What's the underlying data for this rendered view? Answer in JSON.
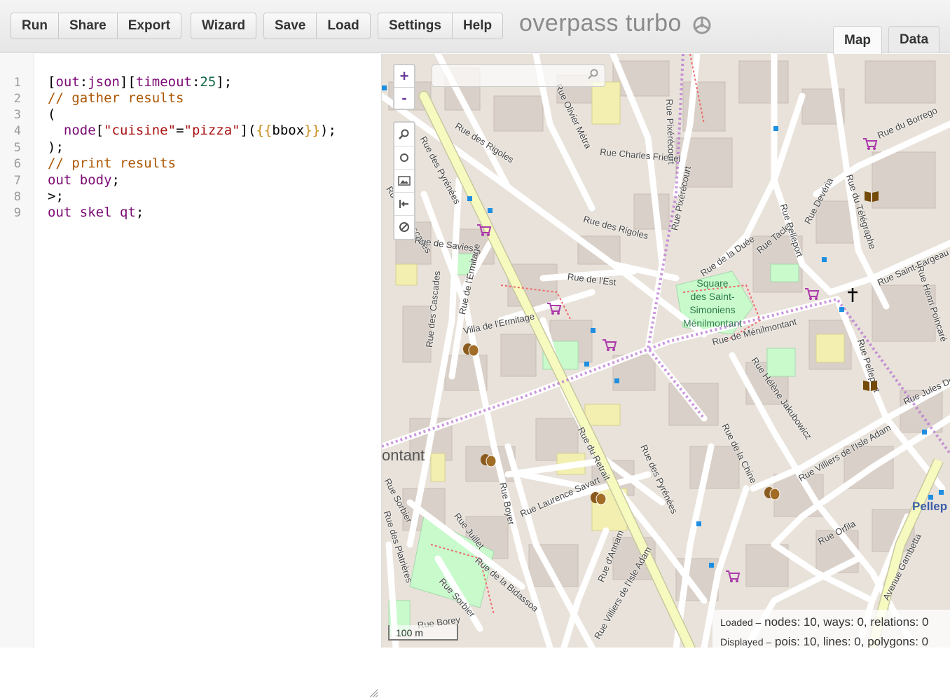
{
  "toolbar": {
    "run": "Run",
    "share": "Share",
    "export": "Export",
    "wizard": "Wizard",
    "save": "Save",
    "load": "Load",
    "settings": "Settings",
    "help": "Help"
  },
  "app": {
    "title": "overpass turbo",
    "logo_icon": "overpass-logo-icon"
  },
  "views": {
    "map": "Map",
    "data": "Data",
    "active": "map"
  },
  "editor": {
    "line_numbers": [
      "1",
      "2",
      "3",
      "4",
      "5",
      "6",
      "7",
      "8",
      "9"
    ],
    "lines": [
      "[out:json][timeout:25];",
      "// gather results",
      "(",
      "  node[\"cuisine\"=\"pizza\"]({{bbox}});",
      ");",
      "// print results",
      "out body;",
      ">;",
      "out skel qt;"
    ]
  },
  "map": {
    "zoom_in": "+",
    "zoom_out": "-",
    "search_placeholder": "",
    "tools": [
      "search-icon",
      "circle-icon",
      "image-icon",
      "jump-icon",
      "cancel-icon"
    ],
    "scale": "100 m",
    "stats": {
      "loaded_label": "Loaded –",
      "loaded_value": "nodes: 10, ways: 0, relations: 0",
      "displayed_label": "Displayed –",
      "displayed_value": "pois: 10, lines: 0, polygons: 0"
    },
    "streets": [
      "Rue des Pyrénées",
      "Rue des Rigoles",
      "Rue Olivier Métra",
      "Rue Charles Friedel",
      "Rue Pixérécourt",
      "Rue du Borrego",
      "Rue du Télégraphe",
      "Rue Saint-Fargeau",
      "Rue Henri Poincaré",
      "Rue de la Duée",
      "Rue Taclet",
      "Rue Pelleport",
      "Rue Devéria",
      "Rue de l'Est",
      "Rue de Ménilmontant",
      "Rue Hélène Jakubowicz",
      "Rue Villiers de l'Isle Adam",
      "Rue de la Chine",
      "Rue Orfila",
      "Avenue Gambetta",
      "Rue Jules Dumien",
      "Villa de l'Ermitage",
      "Rue de l'Ermitage",
      "Rue des Cascades",
      "Rue de Savies",
      "Rue du Retrait",
      "Rue Laurence Savart",
      "Rue Boyer",
      "Rue Juillet",
      "Rue de la Bidassoa",
      "Rue Sorbier",
      "Rue des Platrières",
      "Rue d'Annam",
      "Rue Borey"
    ],
    "park": [
      "Square",
      "des Saint-",
      "Simoniens",
      "Ménilmontant"
    ],
    "places": [
      "ontant",
      "Pellep"
    ],
    "colors": {
      "primary_road": "#f7fabf",
      "road_casing": "#c8c8a0",
      "building": "#d9d0c9",
      "park": "#c8facc",
      "poi_marker": "#1e8ee0",
      "route": "#b36bd0"
    }
  }
}
